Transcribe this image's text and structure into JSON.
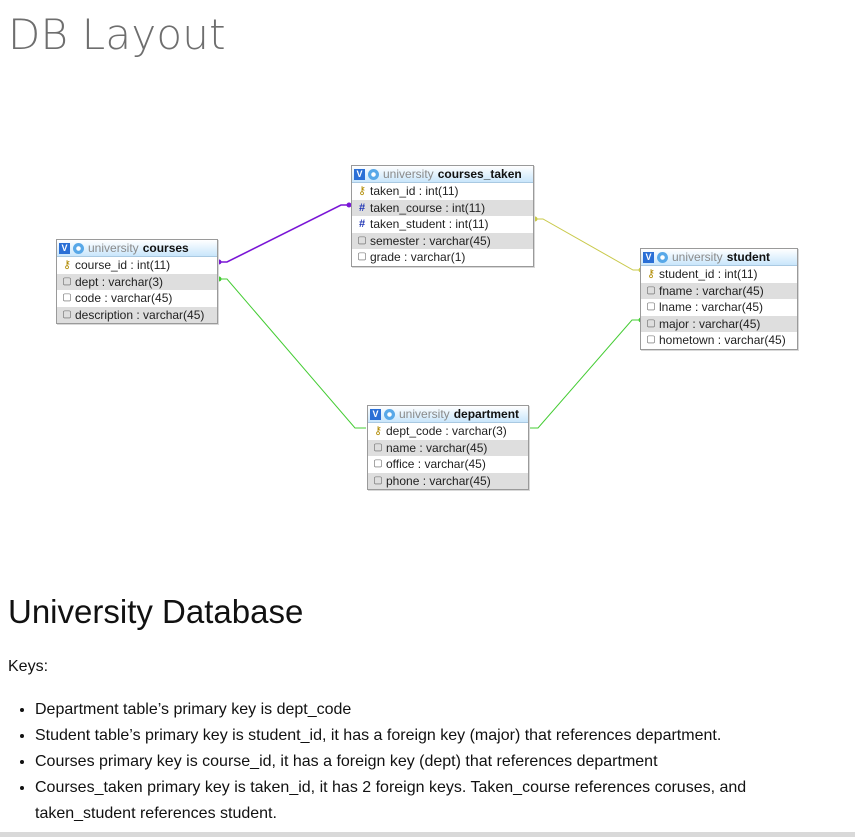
{
  "title": "DB Layout",
  "diagram": {
    "colors": {
      "fk_courses_taken": "#7a16d6",
      "fk_student_taken": "#c9c94a",
      "fk_dept": "#44cc33",
      "header_gradient_end": "#c9e6fb",
      "alt_row": "#dedede"
    },
    "tables": [
      {
        "id": "courses",
        "schema": "university",
        "name": "courses",
        "columns": [
          {
            "icon": "key-icon",
            "text": "course_id : int(11)"
          },
          {
            "icon": "column-icon",
            "text": "dept : varchar(3)"
          },
          {
            "icon": "column-icon",
            "text": "code : varchar(45)"
          },
          {
            "icon": "column-icon",
            "text": "description : varchar(45)"
          }
        ]
      },
      {
        "id": "courses_taken",
        "schema": "university",
        "name": "courses_taken",
        "columns": [
          {
            "icon": "key-icon",
            "text": "taken_id : int(11)"
          },
          {
            "icon": "index-icon",
            "text": "taken_course : int(11)"
          },
          {
            "icon": "index-icon",
            "text": "taken_student : int(11)"
          },
          {
            "icon": "column-icon",
            "text": "semester : varchar(45)"
          },
          {
            "icon": "column-icon",
            "text": "grade : varchar(1)"
          }
        ]
      },
      {
        "id": "student",
        "schema": "university",
        "name": "student",
        "columns": [
          {
            "icon": "key-icon",
            "text": "student_id : int(11)"
          },
          {
            "icon": "column-icon",
            "text": "fname : varchar(45)"
          },
          {
            "icon": "column-icon",
            "text": "lname : varchar(45)"
          },
          {
            "icon": "column-icon",
            "text": "major : varchar(45)"
          },
          {
            "icon": "column-icon",
            "text": "hometown : varchar(45)"
          }
        ]
      },
      {
        "id": "department",
        "schema": "university",
        "name": "department",
        "columns": [
          {
            "icon": "key-icon",
            "text": "dept_code : varchar(3)"
          },
          {
            "icon": "column-icon",
            "text": "name : varchar(45)"
          },
          {
            "icon": "column-icon",
            "text": "office : varchar(45)"
          },
          {
            "icon": "column-icon",
            "text": "phone : varchar(45)"
          }
        ]
      }
    ]
  },
  "section_title": "University Database",
  "keys_label": "Keys:",
  "keys": [
    "Department table’s primary key is dept_code",
    "Student table’s primary key is student_id, it has a foreign key (major) that references department.",
    "Courses primary key is course_id, it has a foreign key (dept) that references department",
    "Courses_taken primary key is taken_id, it has 2 foreign keys. Taken_course references coruses, and taken_student references student."
  ]
}
